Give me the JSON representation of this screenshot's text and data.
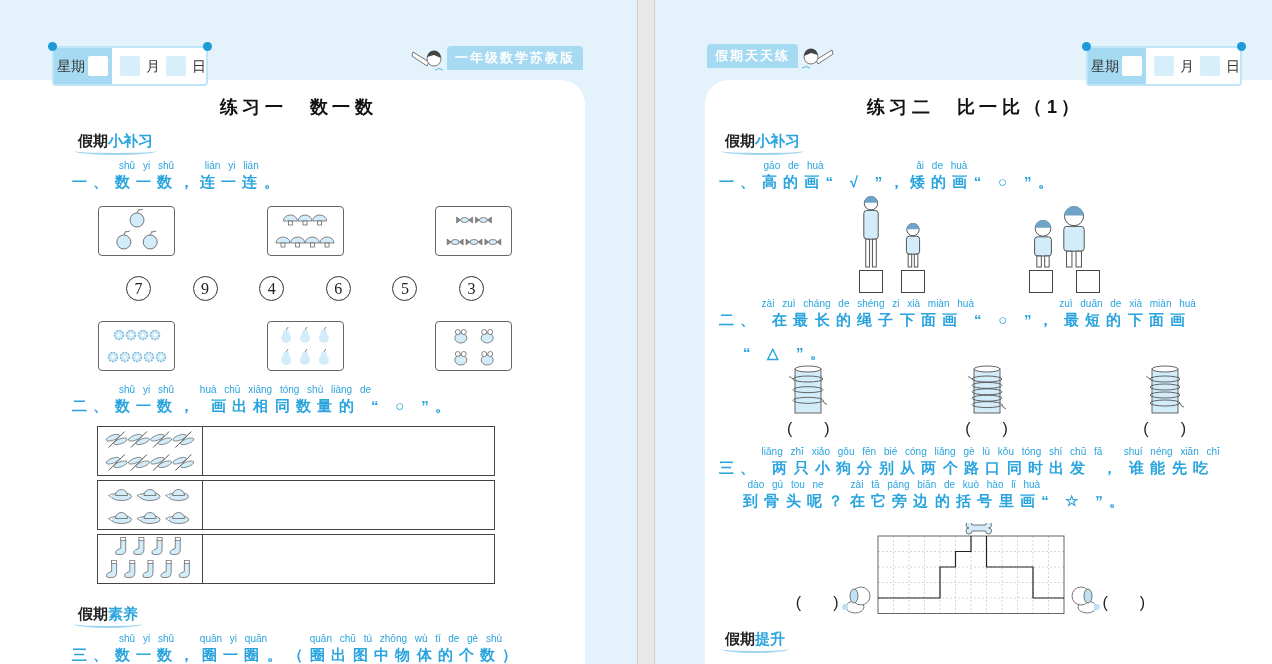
{
  "pages": [
    {
      "kind": "left",
      "date": {
        "week": "星期",
        "month": "月",
        "day": "日"
      },
      "badge": "一年级数学苏教版",
      "title": "练习一　数一数",
      "sections": [
        {
          "heading": {
            "lead": "假期",
            "accent": "小补习"
          },
          "questions": [
            {
              "kind": "match",
              "lines": [
                [
                  {
                    "t": "一、"
                  },
                  {
                    "t": "数一数",
                    "p": "shǔ yi shǔ"
                  },
                  {
                    "t": "，"
                  },
                  {
                    "t": "连一连",
                    "p": "lián yi lián"
                  },
                  {
                    "t": "。"
                  }
                ]
              ],
              "numbers": [
                "7",
                "9",
                "4",
                "6",
                "5",
                "3"
              ]
            },
            {
              "kind": "table",
              "lines": [
                [
                  {
                    "t": "二、"
                  },
                  {
                    "t": "数一数",
                    "p": "shǔ yi shǔ"
                  },
                  {
                    "t": "，"
                  },
                  {
                    "t": "画出相同数量的",
                    "p": "huà chū xiāng tóng shù liàng de"
                  },
                  {
                    "t": "“ ○ ”。"
                  }
                ]
              ]
            }
          ]
        },
        {
          "heading": {
            "lead": "假期",
            "accent": "素养"
          },
          "questions": [
            {
              "kind": "text",
              "lines": [
                [
                  {
                    "t": "三、"
                  },
                  {
                    "t": "数一数",
                    "p": "shǔ yi shǔ"
                  },
                  {
                    "t": "，"
                  },
                  {
                    "t": "圈一圈",
                    "p": "quān yi quān"
                  },
                  {
                    "t": "。（"
                  },
                  {
                    "t": "圈出图中物体的个数",
                    "p": "quān chū tú zhōng wù tǐ de gè shù"
                  },
                  {
                    "t": "）"
                  }
                ]
              ]
            }
          ]
        }
      ]
    },
    {
      "kind": "right",
      "date": {
        "week": "星期",
        "month": "月",
        "day": "日"
      },
      "badge": "假期天天练",
      "title": "练习二　比一比（1）",
      "sections": [
        {
          "heading": {
            "lead": "假期",
            "accent": "小补习"
          },
          "questions": [
            {
              "kind": "heights",
              "lines": [
                [
                  {
                    "t": "一、"
                  },
                  {
                    "t": "高的画",
                    "p": "gāo de huà"
                  },
                  {
                    "t": "“ √ ”，"
                  },
                  {
                    "t": "矮的画",
                    "p": "ǎi de huà"
                  },
                  {
                    "t": "“ ○ ”。"
                  }
                ]
              ]
            },
            {
              "kind": "ropes",
              "lines": [
                [
                  {
                    "t": "二、"
                  },
                  {
                    "t": "在最长的绳子下面画",
                    "p": "zài zuì cháng de shéng zi xià miàn huà"
                  },
                  {
                    "t": "“ ○ ”，"
                  },
                  {
                    "t": "最短的下面画",
                    "p": "zuì duǎn de xià miàn huà"
                  }
                ],
                [
                  {
                    "t": "“ △ ”。"
                  }
                ]
              ],
              "brackets": [
                "(　　)",
                "(　　)",
                "(　　)"
              ]
            },
            {
              "kind": "dogs",
              "lines": [
                [
                  {
                    "t": "三、"
                  },
                  {
                    "t": "两只小狗分别从两个路口同时出发",
                    "p": "liǎng zhī xiǎo gǒu fēn bié cóng liǎng gè lù kǒu tóng shí chū fā"
                  },
                  {
                    "t": "，"
                  },
                  {
                    "t": "谁能先吃",
                    "p": "shuí néng xiān chī"
                  }
                ],
                [
                  {
                    "t": "到骨头呢",
                    "p": "dào gú tou ne"
                  },
                  {
                    "t": "？"
                  },
                  {
                    "t": "在它旁边的括号里画",
                    "p": "zài tā páng biān de kuò hào lǐ huà"
                  },
                  {
                    "t": "“ ☆ ”。"
                  }
                ]
              ],
              "brackets": [
                "(　　)",
                "(　　)"
              ]
            }
          ]
        },
        {
          "heading": {
            "lead": "假期",
            "accent": "提升"
          }
        }
      ]
    }
  ]
}
